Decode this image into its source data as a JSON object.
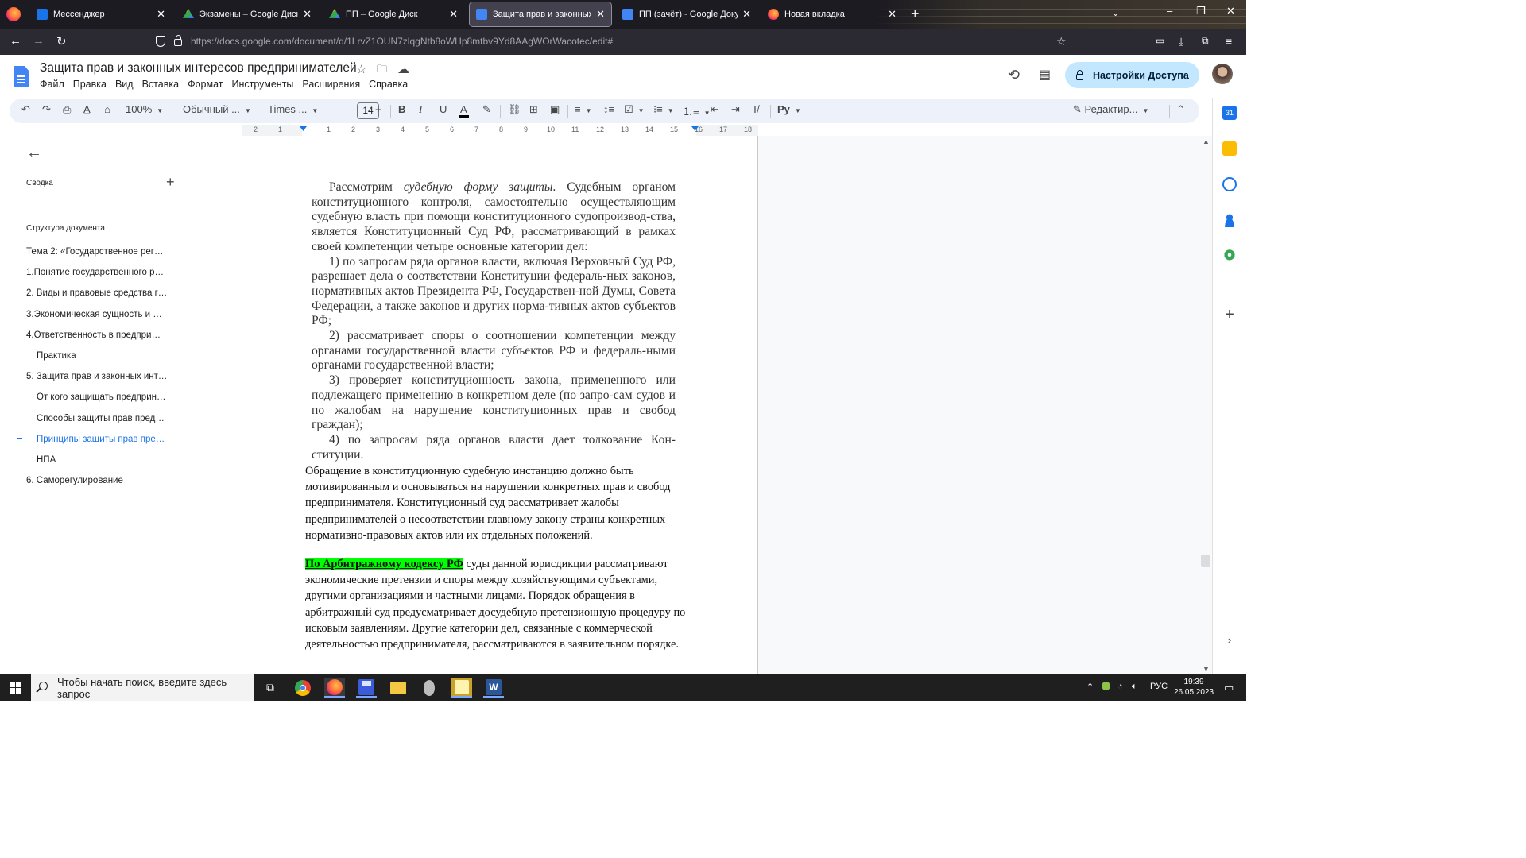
{
  "browser": {
    "tabs": [
      {
        "title": "Мессенджер",
        "fav": "#1a73e8"
      },
      {
        "title": "Экзамены – Google Диск",
        "fav": "#34a853"
      },
      {
        "title": "ПП – Google Диск",
        "fav": "#34a853"
      },
      {
        "title": "Защита прав и законных интере",
        "fav": "#4285f4"
      },
      {
        "title": "ПП (зачёт) - Google Документ",
        "fav": "#4285f4"
      },
      {
        "title": "Новая вкладка",
        "fav": "#ff7139"
      }
    ],
    "new_tab": "+",
    "url": "https://docs.google.com/document/d/1LrvZ1OUN7zlqgNtb8oWHp8mtbv9Yd8AAgWOrWacotec/edit#"
  },
  "docs": {
    "title": "Защита прав и законных интересов предпринимателей",
    "menu": [
      "Файл",
      "Правка",
      "Вид",
      "Вставка",
      "Формат",
      "Инструменты",
      "Расширения",
      "Справка"
    ],
    "share_label": "Настройки Доступа",
    "toolbar": {
      "zoom": "100%",
      "style": "Обычный ...",
      "font": "Times ...",
      "font_size": "14",
      "mode": "Редактир..."
    },
    "ruler_labels": [
      "2",
      "1",
      "1",
      "2",
      "3",
      "4",
      "5",
      "6",
      "7",
      "8",
      "9",
      "10",
      "11",
      "12",
      "13",
      "14",
      "15",
      "16",
      "17",
      "18"
    ]
  },
  "outline": {
    "summary_label": "Сводка",
    "structure_label": "Структура документа",
    "items": [
      {
        "text": "Тема 2: «Государственное рег…",
        "level": 1
      },
      {
        "text": "1.Понятие государственного р…",
        "level": 1
      },
      {
        "text": "2. Виды и правовые средства г…",
        "level": 1
      },
      {
        "text": "3.Экономическая сущность и …",
        "level": 1
      },
      {
        "text": "4.Ответственность в предпри…",
        "level": 1
      },
      {
        "text": "Практика",
        "level": 2
      },
      {
        "text": "5. Защита прав и законных инт…",
        "level": 1
      },
      {
        "text": "От кого защищать предприн…",
        "level": 2
      },
      {
        "text": "Способы защиты прав пред…",
        "level": 2
      },
      {
        "text": "Принципы защиты прав пре…",
        "level": 2,
        "current": true
      },
      {
        "text": "НПА",
        "level": 2
      },
      {
        "text": "6. Саморегулирование",
        "level": 1
      }
    ]
  },
  "content": {
    "book_paragraphs": [
      "Рассмотрим судебную форму защиты. Судебным органом конституционного контроля, самостоятельно осуществляющим судебную власть при помощи конституционного судопроизвод-ства, является Конституционный Суд РФ, рассматривающий в рамках своей компетенции четыре основные категории дел:",
      "1) по запросам ряда органов власти, включая Верховный Суд РФ, разрешает дела о соответствии Конституции федераль-ных законов, нормативных актов Президента РФ, Государствен-ной Думы, Совета Федерации, а также законов и других норма-тивных актов субъектов РФ;",
      "2) рассматривает споры о соотношении компетенции между органами государственной власти субъектов РФ и федераль-ными органами государственной власти;",
      "3) проверяет конституционность закона, примененного или подлежащего применению в конкретном деле (по запро-сам судов и по жалобам на нарушение конституционных прав и свобод граждан);",
      "4) по запросам ряда органов власти дает толкование Кон-ституции."
    ],
    "para_appeal": "Обращение в конституционную судебную инстанцию должно быть мотивированным и основываться на нарушении конкретных прав и свобод предпринимателя. Конституционный суд рассматривает жалобы предпринимателей о несоответствии главному закону страны конкретных нормативно-правовых актов или их отдельных положений.",
    "para_arbitr_highlight": "По Арбитражному кодексу РФ",
    "para_arbitr_rest": " суды данной юрисдикции рассматривают экономические претензии и споры между хозяйствующими субъектами, другими организациями и частными лицами. Порядок обращения в арбитражный суд предусматривает досудебную претензионную процедуру по исковым заявлениям. Другие категории дел, связанные с коммерческой деятельностью предпринимателя, рассматриваются в заявительном порядке."
  },
  "taskbar": {
    "search_placeholder": "Чтобы начать поиск, введите здесь запрос",
    "lang": "РУС",
    "time": "19:39",
    "date": "26.05.2023"
  }
}
